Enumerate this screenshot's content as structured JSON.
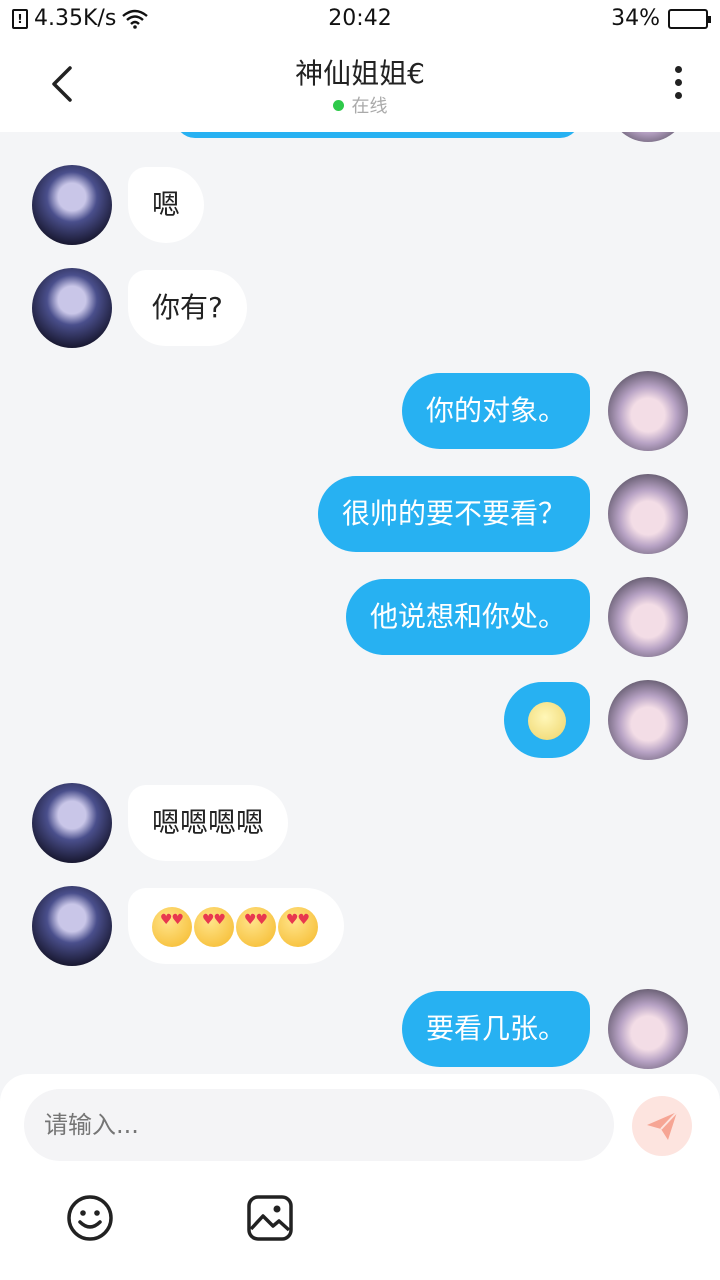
{
  "status_bar": {
    "speed": "4.35K/s",
    "time": "20:42",
    "battery": "34%",
    "sim_label": "!"
  },
  "header": {
    "title": "神仙姐姐€",
    "status": "在线"
  },
  "messages": [
    {
      "side": "in",
      "text": "嗯"
    },
    {
      "side": "in",
      "text": "你有?"
    },
    {
      "side": "out",
      "text": "你的对象。"
    },
    {
      "side": "out",
      "text": "很帅的要不要看？"
    },
    {
      "side": "out",
      "text": "他说想和你处。"
    },
    {
      "side": "out",
      "emoji": "moon-face-emoji"
    },
    {
      "side": "in",
      "text": "嗯嗯嗯嗯"
    },
    {
      "side": "in",
      "emoji": "heart-eyes-emoji",
      "count": 4
    },
    {
      "side": "out",
      "text": "要看几张。"
    }
  ],
  "composer": {
    "placeholder": "请输入..."
  },
  "icons": {
    "send": "send-icon",
    "emoji": "smiley-icon",
    "image": "image-icon"
  },
  "colors": {
    "outgoing_bubble": "#27b1f2",
    "incoming_bubble": "#ffffff",
    "online_dot": "#2ec94a",
    "send_bg": "#fde4df"
  }
}
